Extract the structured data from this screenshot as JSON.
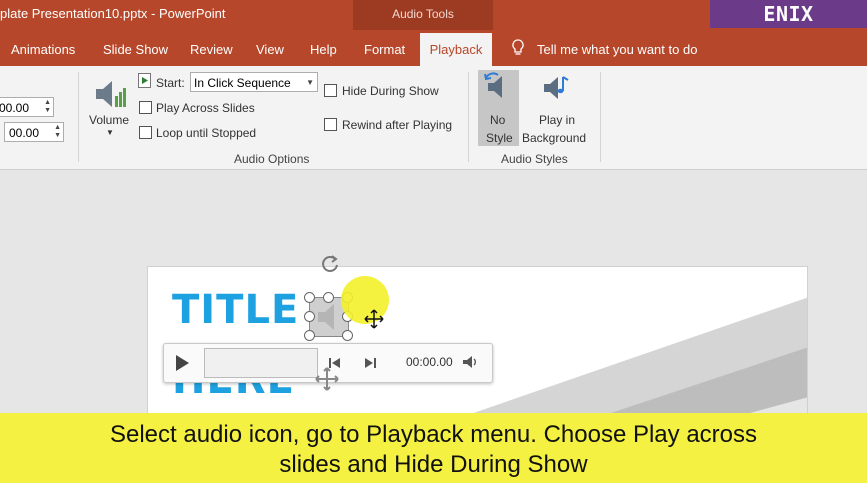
{
  "window": {
    "title": "plate Presentation10.pptx  -  PowerPoint",
    "context_tab_group": "Audio Tools",
    "watermark": "ENIX Tutorials"
  },
  "tabs": [
    {
      "label": "Animations"
    },
    {
      "label": "Slide Show"
    },
    {
      "label": "Review"
    },
    {
      "label": "View"
    },
    {
      "label": "Help"
    },
    {
      "label": "Format"
    },
    {
      "label": "Playback",
      "active": true
    }
  ],
  "tell_me": "Tell me what you want to do",
  "ribbon": {
    "fade_in": "00.00",
    "fade_out": "00.00",
    "volume_label": "Volume",
    "start_label": "Start:",
    "start_value": "In Click Sequence",
    "play_across_slides": "Play Across Slides",
    "loop_until_stopped": "Loop until Stopped",
    "hide_during_show": "Hide During Show",
    "rewind_after_playing": "Rewind after Playing",
    "audio_options_group": "Audio Options",
    "no_style_line1": "No",
    "no_style_line2": "Style",
    "play_bg_line1": "Play in",
    "play_bg_line2": "Background",
    "audio_styles_group": "Audio Styles"
  },
  "slide": {
    "title_line1": "TITLE",
    "title_line2": "HERE"
  },
  "player": {
    "time": "00:00.00"
  },
  "caption": {
    "line1": "Select audio icon, go to Playback menu. Choose Play across",
    "line2": "slides and Hide During Show"
  },
  "colors": {
    "ribbon_accent": "#b7472a",
    "title_blue": "#1ea1e0",
    "caption_yellow": "#f4f142"
  }
}
